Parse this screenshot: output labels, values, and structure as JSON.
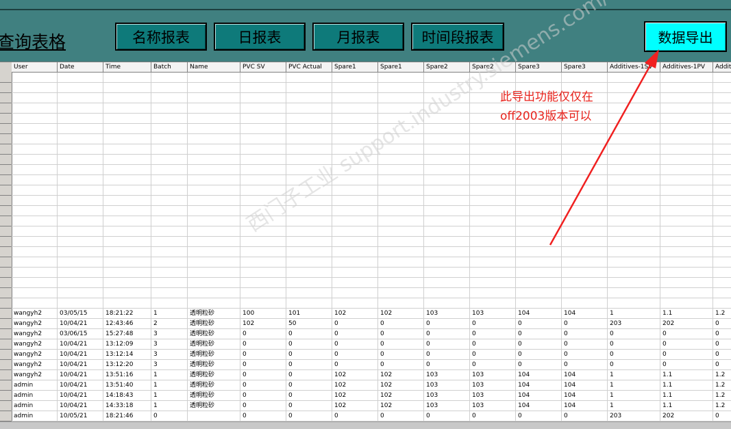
{
  "title": "查询表格",
  "buttons": {
    "name_report": "名称报表",
    "daily_report": "日报表",
    "monthly_report": "月报表",
    "period_report": "时间段报表",
    "export": "数据导出"
  },
  "annotation": {
    "line1": "此导出功能仅仅在",
    "line2": "off2003版本可以"
  },
  "watermark": "西门子工业 support.industry.siemens.com/cs 找答案",
  "table": {
    "columns": [
      "User",
      "Date",
      "Time",
      "Batch",
      "Name",
      "PVC SV",
      "PVC Actual",
      "Spare1",
      "Spare1",
      "Spare2",
      "Spare2",
      "Spare3",
      "Spare3",
      "Additives-1SV",
      "Additives-1PV",
      "Additi"
    ],
    "empty_rows": 23,
    "rows": [
      [
        "wangyh2",
        "03/05/15",
        "18:21:22",
        "1",
        "透明粒砂",
        "100",
        "101",
        "102",
        "102",
        "103",
        "103",
        "104",
        "104",
        "1",
        "1.1",
        "1.2"
      ],
      [
        "wangyh2",
        "10/04/21",
        "12:43:46",
        "2",
        "透明粒砂",
        "102",
        "50",
        "0",
        "0",
        "0",
        "0",
        "0",
        "0",
        "203",
        "202",
        "0"
      ],
      [
        "wangyh2",
        "03/06/15",
        "15:27:48",
        "3",
        "透明粒砂",
        "0",
        "0",
        "0",
        "0",
        "0",
        "0",
        "0",
        "0",
        "0",
        "0",
        "0"
      ],
      [
        "wangyh2",
        "10/04/21",
        "13:12:09",
        "3",
        "透明粒砂",
        "0",
        "0",
        "0",
        "0",
        "0",
        "0",
        "0",
        "0",
        "0",
        "0",
        "0"
      ],
      [
        "wangyh2",
        "10/04/21",
        "13:12:14",
        "3",
        "透明粒砂",
        "0",
        "0",
        "0",
        "0",
        "0",
        "0",
        "0",
        "0",
        "0",
        "0",
        "0"
      ],
      [
        "wangyh2",
        "10/04/21",
        "13:12:20",
        "3",
        "透明粒砂",
        "0",
        "0",
        "0",
        "0",
        "0",
        "0",
        "0",
        "0",
        "0",
        "0",
        "0"
      ],
      [
        "wangyh2",
        "10/04/21",
        "13:51:16",
        "1",
        "透明粒砂",
        "0",
        "0",
        "102",
        "102",
        "103",
        "103",
        "104",
        "104",
        "1",
        "1.1",
        "1.2"
      ],
      [
        "admin",
        "10/04/21",
        "13:51:40",
        "1",
        "透明粒砂",
        "0",
        "0",
        "102",
        "102",
        "103",
        "103",
        "104",
        "104",
        "1",
        "1.1",
        "1.2"
      ],
      [
        "admin",
        "10/04/21",
        "14:18:43",
        "1",
        "透明粒砂",
        "0",
        "0",
        "102",
        "102",
        "103",
        "103",
        "104",
        "104",
        "1",
        "1.1",
        "1.2"
      ],
      [
        "admin",
        "10/04/21",
        "14:33:18",
        "1",
        "透明粒砂",
        "0",
        "0",
        "102",
        "102",
        "103",
        "103",
        "104",
        "104",
        "1",
        "1.1",
        "1.2"
      ],
      [
        "admin",
        "10/05/21",
        "18:21:46",
        "0",
        "",
        "0",
        "0",
        "0",
        "0",
        "0",
        "0",
        "0",
        "0",
        "203",
        "202",
        "0"
      ]
    ]
  }
}
